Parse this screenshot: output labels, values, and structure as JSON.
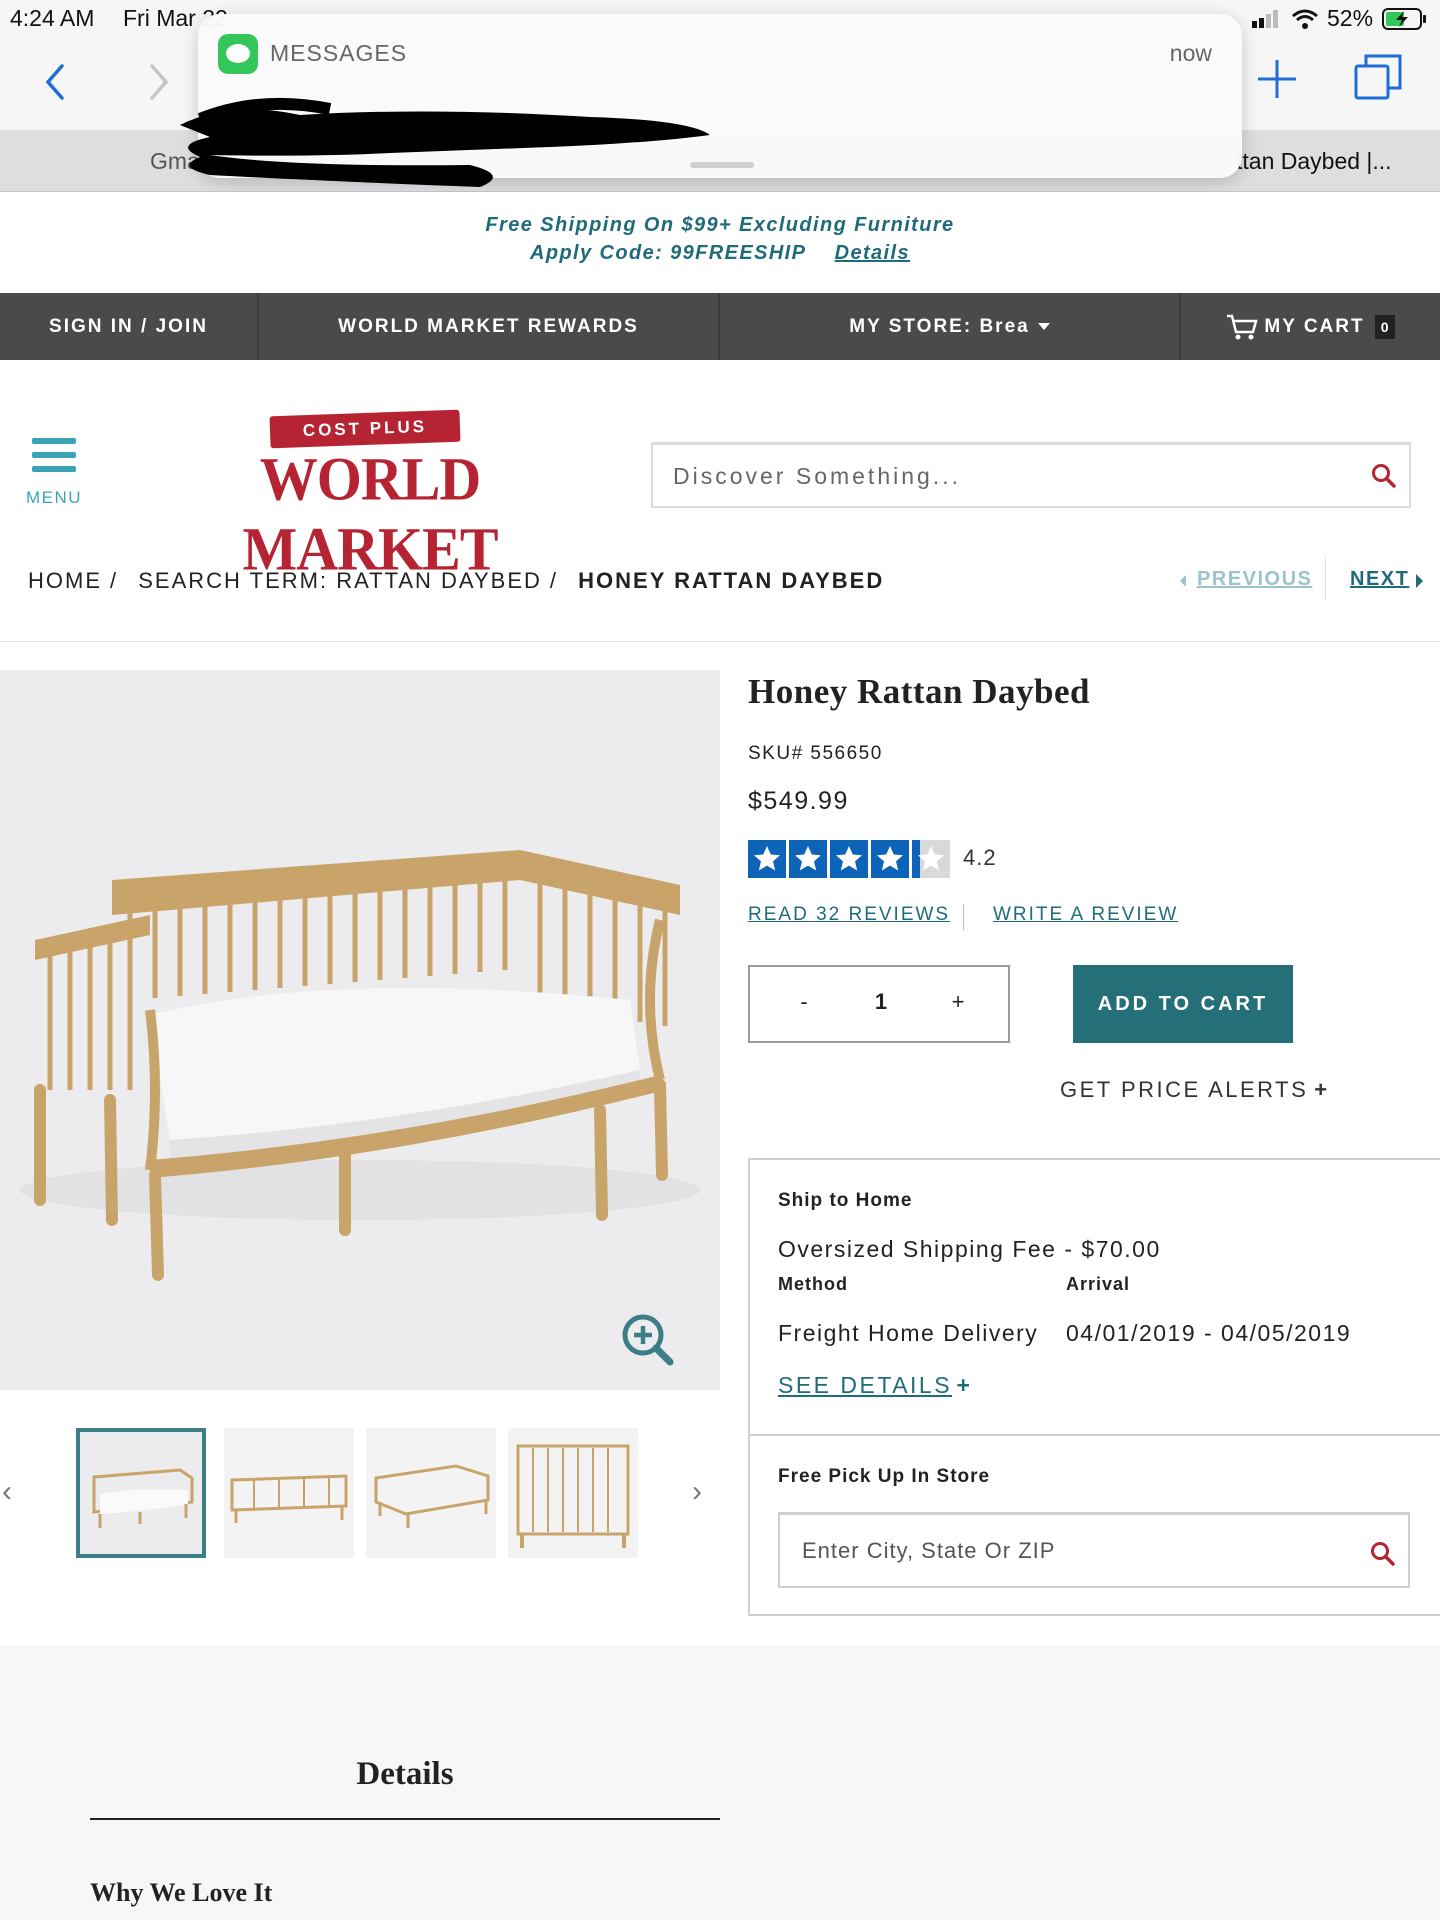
{
  "status_bar": {
    "time": "4:24 AM",
    "date": "Fri Mar 22",
    "battery": "52%"
  },
  "browser": {
    "tabs": [
      {
        "title": "Gma"
      },
      {
        "title": ""
      },
      {
        "title": ""
      },
      {
        "title": "ttan Daybed |..."
      }
    ]
  },
  "notification": {
    "app_name": "MESSAGES",
    "time": "now"
  },
  "promo": {
    "line1": "Free Shipping On $99+ Excluding Furniture",
    "line2": "Apply Code: 99FREESHIP",
    "details_link": "Details"
  },
  "topnav": {
    "sign_in": "SIGN IN / JOIN",
    "rewards": "WORLD MARKET REWARDS",
    "store_label": "MY STORE:",
    "store_name": "Brea",
    "cart_label": "MY CART",
    "cart_count": "0"
  },
  "header": {
    "menu_label": "MENU",
    "logo_ribbon": "COST PLUS",
    "logo_word": "WORLD MARKET",
    "search_placeholder": "Discover Something..."
  },
  "breadcrumb": {
    "home": "HOME",
    "search": "SEARCH TERM: RATTAN DAYBED",
    "current": "HONEY RATTAN DAYBED",
    "previous": "PREVIOUS",
    "next": "NEXT"
  },
  "product": {
    "title": "Honey Rattan Daybed",
    "sku": "SKU# 556650",
    "price": "$549.99",
    "rating": 4.2,
    "rating_text": "4.2",
    "read_reviews": "READ 32 REVIEWS",
    "write_review": "WRITE A REVIEW",
    "quantity": "1",
    "qty_minus": "-",
    "qty_plus": "+",
    "add_to_cart": "ADD TO CART",
    "price_alerts": "GET PRICE ALERTS",
    "price_alerts_plus": "+"
  },
  "shipping": {
    "ship_heading": "Ship to Home",
    "fee": "Oversized Shipping Fee - $70.00",
    "method_label": "Method",
    "arrival_label": "Arrival",
    "method_value": "Freight Home Delivery",
    "arrival_value": "04/01/2019 - 04/05/2019",
    "see_details": "SEE DETAILS",
    "see_details_plus": "+",
    "pickup_heading": "Free Pick Up In Store",
    "zip_placeholder": "Enter City, State Or ZIP"
  },
  "details": {
    "tab_label": "Details",
    "why_heading": "Why We Love It"
  },
  "colors": {
    "teal_dark": "#256f78",
    "teal_link": "#1e6b7a",
    "brand_red": "#b62433",
    "nav_gray": "#4a4a4c",
    "star_blue": "#0d63b8"
  }
}
